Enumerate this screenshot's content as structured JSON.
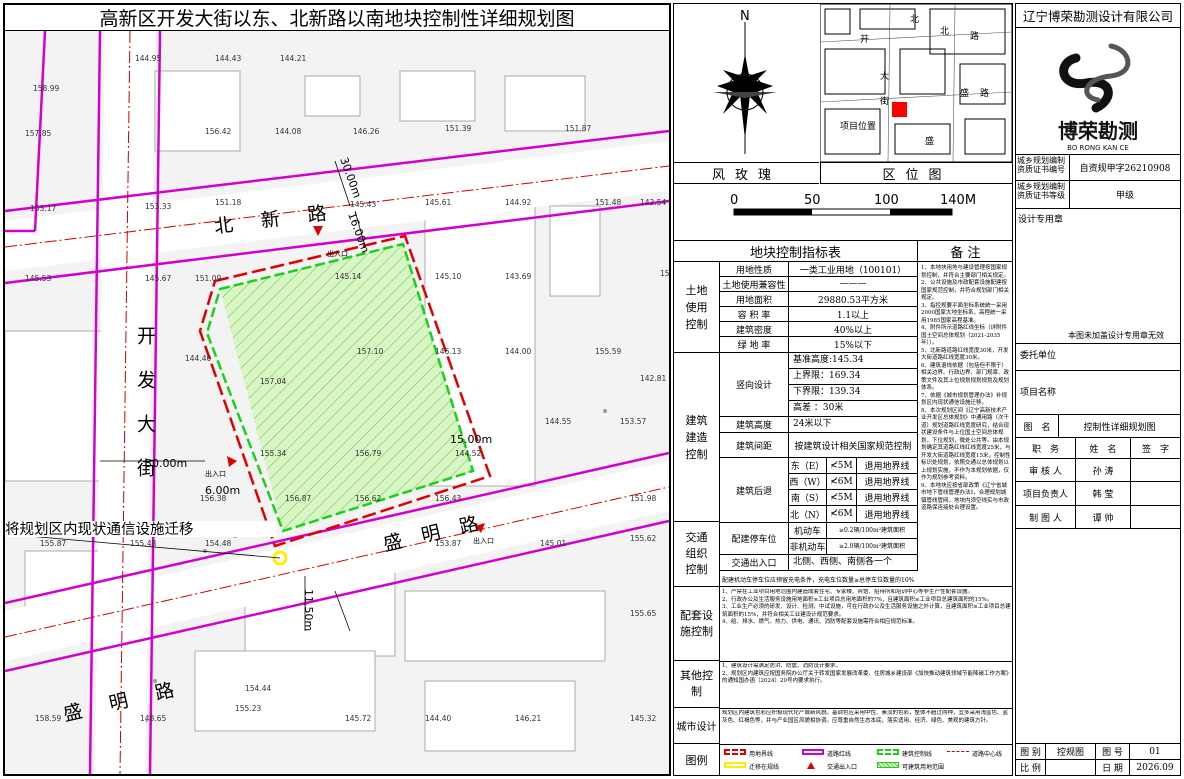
{
  "map": {
    "title": "高新区开发大街以东、北新路以南地块控制性详细规划图",
    "roads": {
      "north": "北新路",
      "west": "开发大街",
      "south_east": "盛明路",
      "south_west": "盛明路"
    },
    "widths": {
      "a": "30.00m",
      "b": "16.00m",
      "c": "30.00m",
      "d": "6.00m",
      "e": "15.00m",
      "f": "11.50m"
    },
    "entrances": [
      "出入口",
      "出入口",
      "出入口"
    ],
    "annotation": "将规划区内现状通信设施迁移",
    "elevations": [
      "158.99",
      "144.95",
      "144.43",
      "144.21",
      "157.85",
      "156.42",
      "144.08",
      "146.26",
      "151.39",
      "151.87",
      "153.17",
      "153.33",
      "151.18",
      "145.43",
      "145.61",
      "144.92",
      "151.48",
      "142.54",
      "145.53",
      "145.67",
      "151.09",
      "145.14",
      "145.10",
      "143.69",
      "156.83",
      "144.40",
      "157.04",
      "157.10",
      "146.13",
      "144.00",
      "155.59",
      "142.81",
      "155.34",
      "156.79",
      "144.52",
      "144.55",
      "153.57",
      "156.38",
      "156.87",
      "156.62",
      "156.43",
      "151.98",
      "155.87",
      "155.48",
      "154.48",
      "153.87",
      "145.01",
      "155.62",
      "155.65",
      "158.59",
      "148.65",
      "155.23",
      "154.44",
      "145.72",
      "144.40",
      "146.21",
      "145.32"
    ]
  },
  "compass": {
    "north": "N",
    "label": "风玫瑰"
  },
  "location": {
    "label": "区位图",
    "tag": "项目位置",
    "streets": [
      "开",
      "北",
      "大",
      "盛",
      "路",
      "路",
      "街",
      "北",
      "盛"
    ]
  },
  "scale": {
    "ticks": [
      "0",
      "50",
      "100",
      "140M"
    ]
  },
  "table": {
    "title": "地块控制指标表",
    "remarks_header": "备  注",
    "groups": [
      {
        "name": "土地使用控制",
        "rows": [
          [
            "用地性质",
            "一类工业用地（100101）"
          ],
          [
            "土地使用兼容性",
            "———"
          ],
          [
            "用地面积",
            "29880.53平方米"
          ],
          [
            "容 积 率",
            "1.1以上"
          ],
          [
            "建筑密度",
            "40%以上"
          ],
          [
            "绿 地 率",
            "15%以下"
          ]
        ]
      },
      {
        "name": "建筑建造控制",
        "vertical": {
          "label": "竖向设计",
          "items": [
            "基准高度:145.34",
            "上界限：169.34",
            "下界限：139.34",
            "高差 ：30米"
          ]
        },
        "height": [
          "建筑高度",
          "24米以下"
        ],
        "spacing": [
          "建筑间距",
          "按建筑设计相关国家规范控制"
        ],
        "setback": {
          "label": "建筑后退",
          "items": [
            [
              "东（E）",
              "≮5M",
              "退用地界线"
            ],
            [
              "西（W）",
              "≮6M",
              "退用地界线"
            ],
            [
              "南（S）",
              "≮5M",
              "退用地界线"
            ],
            [
              "北（N）",
              "≮6M",
              "退用地界线"
            ]
          ]
        }
      },
      {
        "name": "交通组织控制",
        "parking": {
          "label": "配建停车位",
          "items": [
            [
              "机动车",
              "≥0.2辆/100m²建筑面积"
            ],
            [
              "非机动车",
              "≥2.0辆/100m²建筑面积"
            ]
          ]
        },
        "access": [
          "交通出入口",
          "北侧、西侧、南侧各一个"
        ],
        "note": "配建机动车停车位应预留充电条件，充电车位数量≥总停车位数量的10%"
      }
    ],
    "remarks": [
      "1、本地块用地与建设管理按国家规划控制，并符合主要部门相关规定。",
      "2、公共设施及市政配套设施配建按国家规范控制，并符合规划部门相关规定。",
      "3、指控规要平面坐标系统统一采用2000国家大地坐标系，高程统一采用1985国家高程基准。",
      "4、附件所示道路红线坐标（详附件国土空间总体规划（2021-2035年））。",
      "5、北新路道路红线宽度30米，开发大街道路红线宽度30米。",
      "6、建筑退线依据（包括但不限于）相关边界、行政边界、部门规章、政策文件及其上位规划规划规划及规划体系。",
      "7、依据《城市规划管理办法》补规划区内现状通信设施迁移。",
      "8、本次规划区间《辽宁高新技术产业开发区总体规划》中通用路（次干道）规划道路红线宽度研究，结合现状建设条件与上位国土空间总体规划，下位规划，微处公共等。由本规划确定其道路红线红线宽度25米，与开发大街道路红线宽度15米，控制性标识处规划，依照交通以总体规划以上规划实施，不作为本规划依据，仅作为规划参考资料。",
      "9、本地块应按省部政策《辽宁省城市地下管线管理办法》，合理规划城镇管线管网，地块内须空线实与市政道路保连接处合理设置。"
    ],
    "side": [
      {
        "name": "配套设施控制",
        "text": "1、严禁在工业项目用地范围内建造成套住宅、专家楼、宾馆、招待所和培训中心等非生产性配套设施。\n2、行政办公及生活服务设施用地面积≤工业项目总用地面积的7%，且建筑面积≤工业项目总建筑面积的15%。\n3、工业生产必须的研发、设计、检测、中试设施，可在行政办公及生活服务设施之外计算，且建筑面积≤工业项目总建筑面积的15%，并符合相关工业建设计规范要求。\n4、给、排水、燃气、热力、供电、通讯、消防等配套设施需符合相应规范标准。"
      },
      {
        "name": "其他控制",
        "text": "1、建筑设计需满足防洪、防震、消防设计要求。\n2、规划区内建筑应按国务院办公厅关于转发国家发展改革委、住房城乡建设部《加快推动建筑领域节能降碳工作方案》的通知国办函（2024）20号内要求执行。"
      },
      {
        "name": "城市设计",
        "text": "规划区内建筑色彩应积极现代化产城新风貌。基调色应采用中性、素淡的色彩，整体不超过两种，宜多采用浅蓝色、蓝灰色、红褐色等，并与产业园区风貌相协调。应尊重自然生态本底，落实适用、经济、绿色、美观的建筑方针。"
      },
      {
        "name": "图例",
        "legend": [
          "用地界线",
          "道路红线",
          "建筑控制线",
          "道路中心线",
          "迁移在规线",
          "交通出入口",
          "可建筑用地范围"
        ]
      }
    ]
  },
  "titleblock": {
    "company": "辽宁博荣勘测设计有限公司",
    "logo_cn": "博荣勘测",
    "logo_en": "BO RONG KAN CE",
    "rows": [
      [
        "城乡规划编制资质证书编号",
        "自资规甲字26210908"
      ],
      [
        "城乡规划编制资质证书等级",
        "甲级"
      ]
    ],
    "seal_label": "设计专用章",
    "seal_note": "本图未加盖设计专用章无效",
    "client": "委托单位",
    "project": "项目名称",
    "drawing": [
      "图　名",
      "控制性详细规划图"
    ],
    "staff_header": [
      "职　务",
      "姓　名",
      "签　字"
    ],
    "staff": [
      [
        "审 核 人",
        "孙 涛"
      ],
      [
        "项目负责人",
        "韩 莹"
      ],
      [
        "制 图 人",
        "谭 帅"
      ]
    ],
    "foot": [
      "图 别",
      "控规图",
      "图 号",
      "01",
      "比 例",
      "",
      "日 期",
      "2026.09"
    ]
  }
}
